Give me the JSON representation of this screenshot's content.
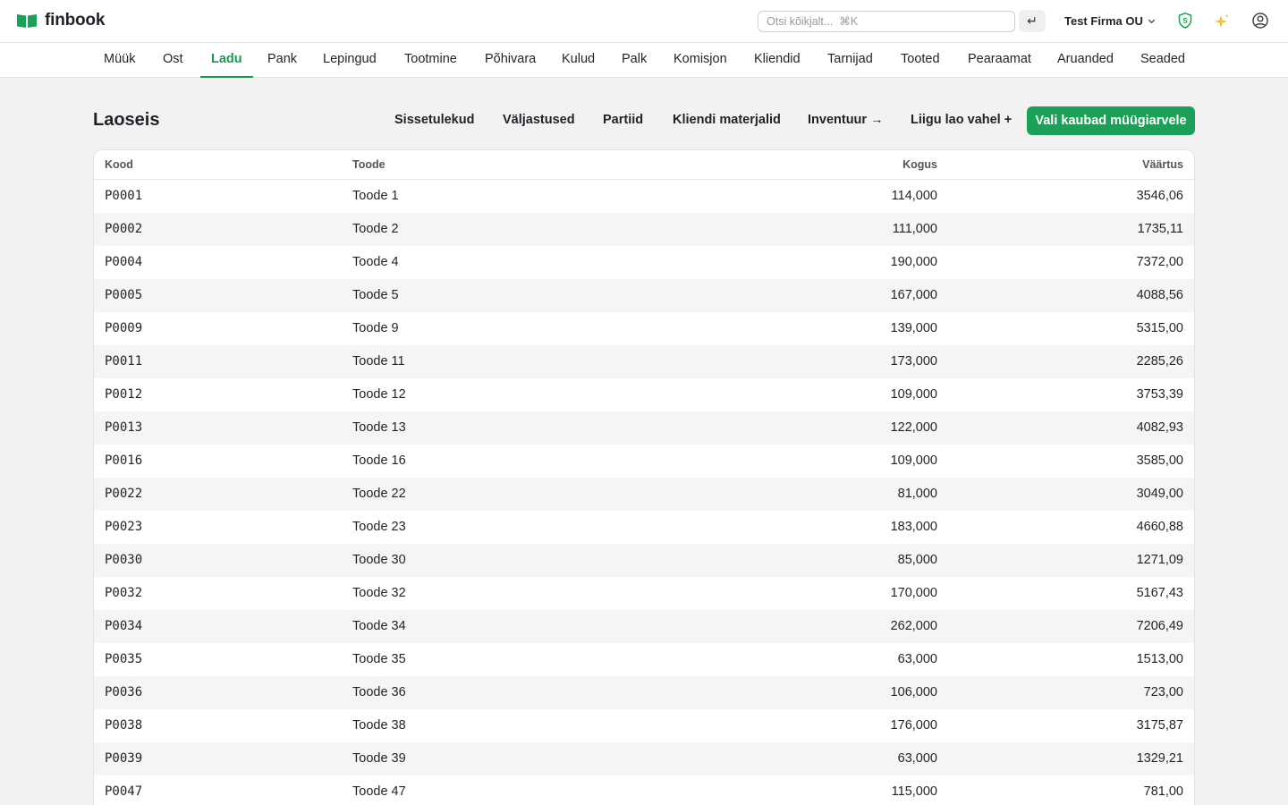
{
  "app": {
    "name": "finbook"
  },
  "header": {
    "search_placeholder": "Otsi kõikjalt...  ⌘K",
    "enter_symbol": "↵",
    "company": "Test Firma OU",
    "icons": [
      "shield-s-icon",
      "sparkle-icon",
      "user-circle-icon"
    ]
  },
  "nav": {
    "active": "Ladu",
    "tabs": [
      {
        "label": "Müük"
      },
      {
        "label": "Ost"
      },
      {
        "label": "Ladu"
      },
      {
        "label": "Pank"
      },
      {
        "label": "Lepingud"
      },
      {
        "label": "Tootmine"
      },
      {
        "label": "Põhivara"
      },
      {
        "label": "Kulud"
      },
      {
        "label": "Palk"
      },
      {
        "label": "Komisjon"
      },
      {
        "label": "Kliendid"
      },
      {
        "label": "Tarnijad"
      },
      {
        "label": "Tooted"
      },
      {
        "label": "Pearaamat"
      },
      {
        "label": "Aruanded"
      },
      {
        "label": "Seaded"
      }
    ]
  },
  "page": {
    "title": "Laoseis",
    "actions": [
      {
        "label": "Sissetulekud"
      },
      {
        "label": "Väljastused"
      },
      {
        "label": "Partiid"
      },
      {
        "label": "Kliendi materjalid"
      },
      {
        "label": "Inventuur →"
      },
      {
        "label": "Liigu lao vahel +"
      }
    ],
    "primary_action": "Vali kaubad müügiarvele"
  },
  "table": {
    "columns": {
      "kood": "Kood",
      "toode": "Toode",
      "kogus": "Kogus",
      "vaartus": "Väärtus"
    },
    "rows": [
      {
        "kood": "P0001",
        "toode": "Toode 1",
        "kogus": "114,000",
        "vaartus": "3546,06"
      },
      {
        "kood": "P0002",
        "toode": "Toode 2",
        "kogus": "111,000",
        "vaartus": "1735,11"
      },
      {
        "kood": "P0004",
        "toode": "Toode 4",
        "kogus": "190,000",
        "vaartus": "7372,00"
      },
      {
        "kood": "P0005",
        "toode": "Toode 5",
        "kogus": "167,000",
        "vaartus": "4088,56"
      },
      {
        "kood": "P0009",
        "toode": "Toode 9",
        "kogus": "139,000",
        "vaartus": "5315,00"
      },
      {
        "kood": "P0011",
        "toode": "Toode 11",
        "kogus": "173,000",
        "vaartus": "2285,26"
      },
      {
        "kood": "P0012",
        "toode": "Toode 12",
        "kogus": "109,000",
        "vaartus": "3753,39"
      },
      {
        "kood": "P0013",
        "toode": "Toode 13",
        "kogus": "122,000",
        "vaartus": "4082,93"
      },
      {
        "kood": "P0016",
        "toode": "Toode 16",
        "kogus": "109,000",
        "vaartus": "3585,00"
      },
      {
        "kood": "P0022",
        "toode": "Toode 22",
        "kogus": "81,000",
        "vaartus": "3049,00"
      },
      {
        "kood": "P0023",
        "toode": "Toode 23",
        "kogus": "183,000",
        "vaartus": "4660,88"
      },
      {
        "kood": "P0030",
        "toode": "Toode 30",
        "kogus": "85,000",
        "vaartus": "1271,09"
      },
      {
        "kood": "P0032",
        "toode": "Toode 32",
        "kogus": "170,000",
        "vaartus": "5167,43"
      },
      {
        "kood": "P0034",
        "toode": "Toode 34",
        "kogus": "262,000",
        "vaartus": "7206,49"
      },
      {
        "kood": "P0035",
        "toode": "Toode 35",
        "kogus": "63,000",
        "vaartus": "1513,00"
      },
      {
        "kood": "P0036",
        "toode": "Toode 36",
        "kogus": "106,000",
        "vaartus": "723,00"
      },
      {
        "kood": "P0038",
        "toode": "Toode 38",
        "kogus": "176,000",
        "vaartus": "3175,87"
      },
      {
        "kood": "P0039",
        "toode": "Toode 39",
        "kogus": "63,000",
        "vaartus": "1329,21"
      },
      {
        "kood": "P0047",
        "toode": "Toode 47",
        "kogus": "115,000",
        "vaartus": "781,00"
      }
    ]
  },
  "colors": {
    "brand_green": "#1aa157",
    "active_tab": "#1a9a4b"
  }
}
